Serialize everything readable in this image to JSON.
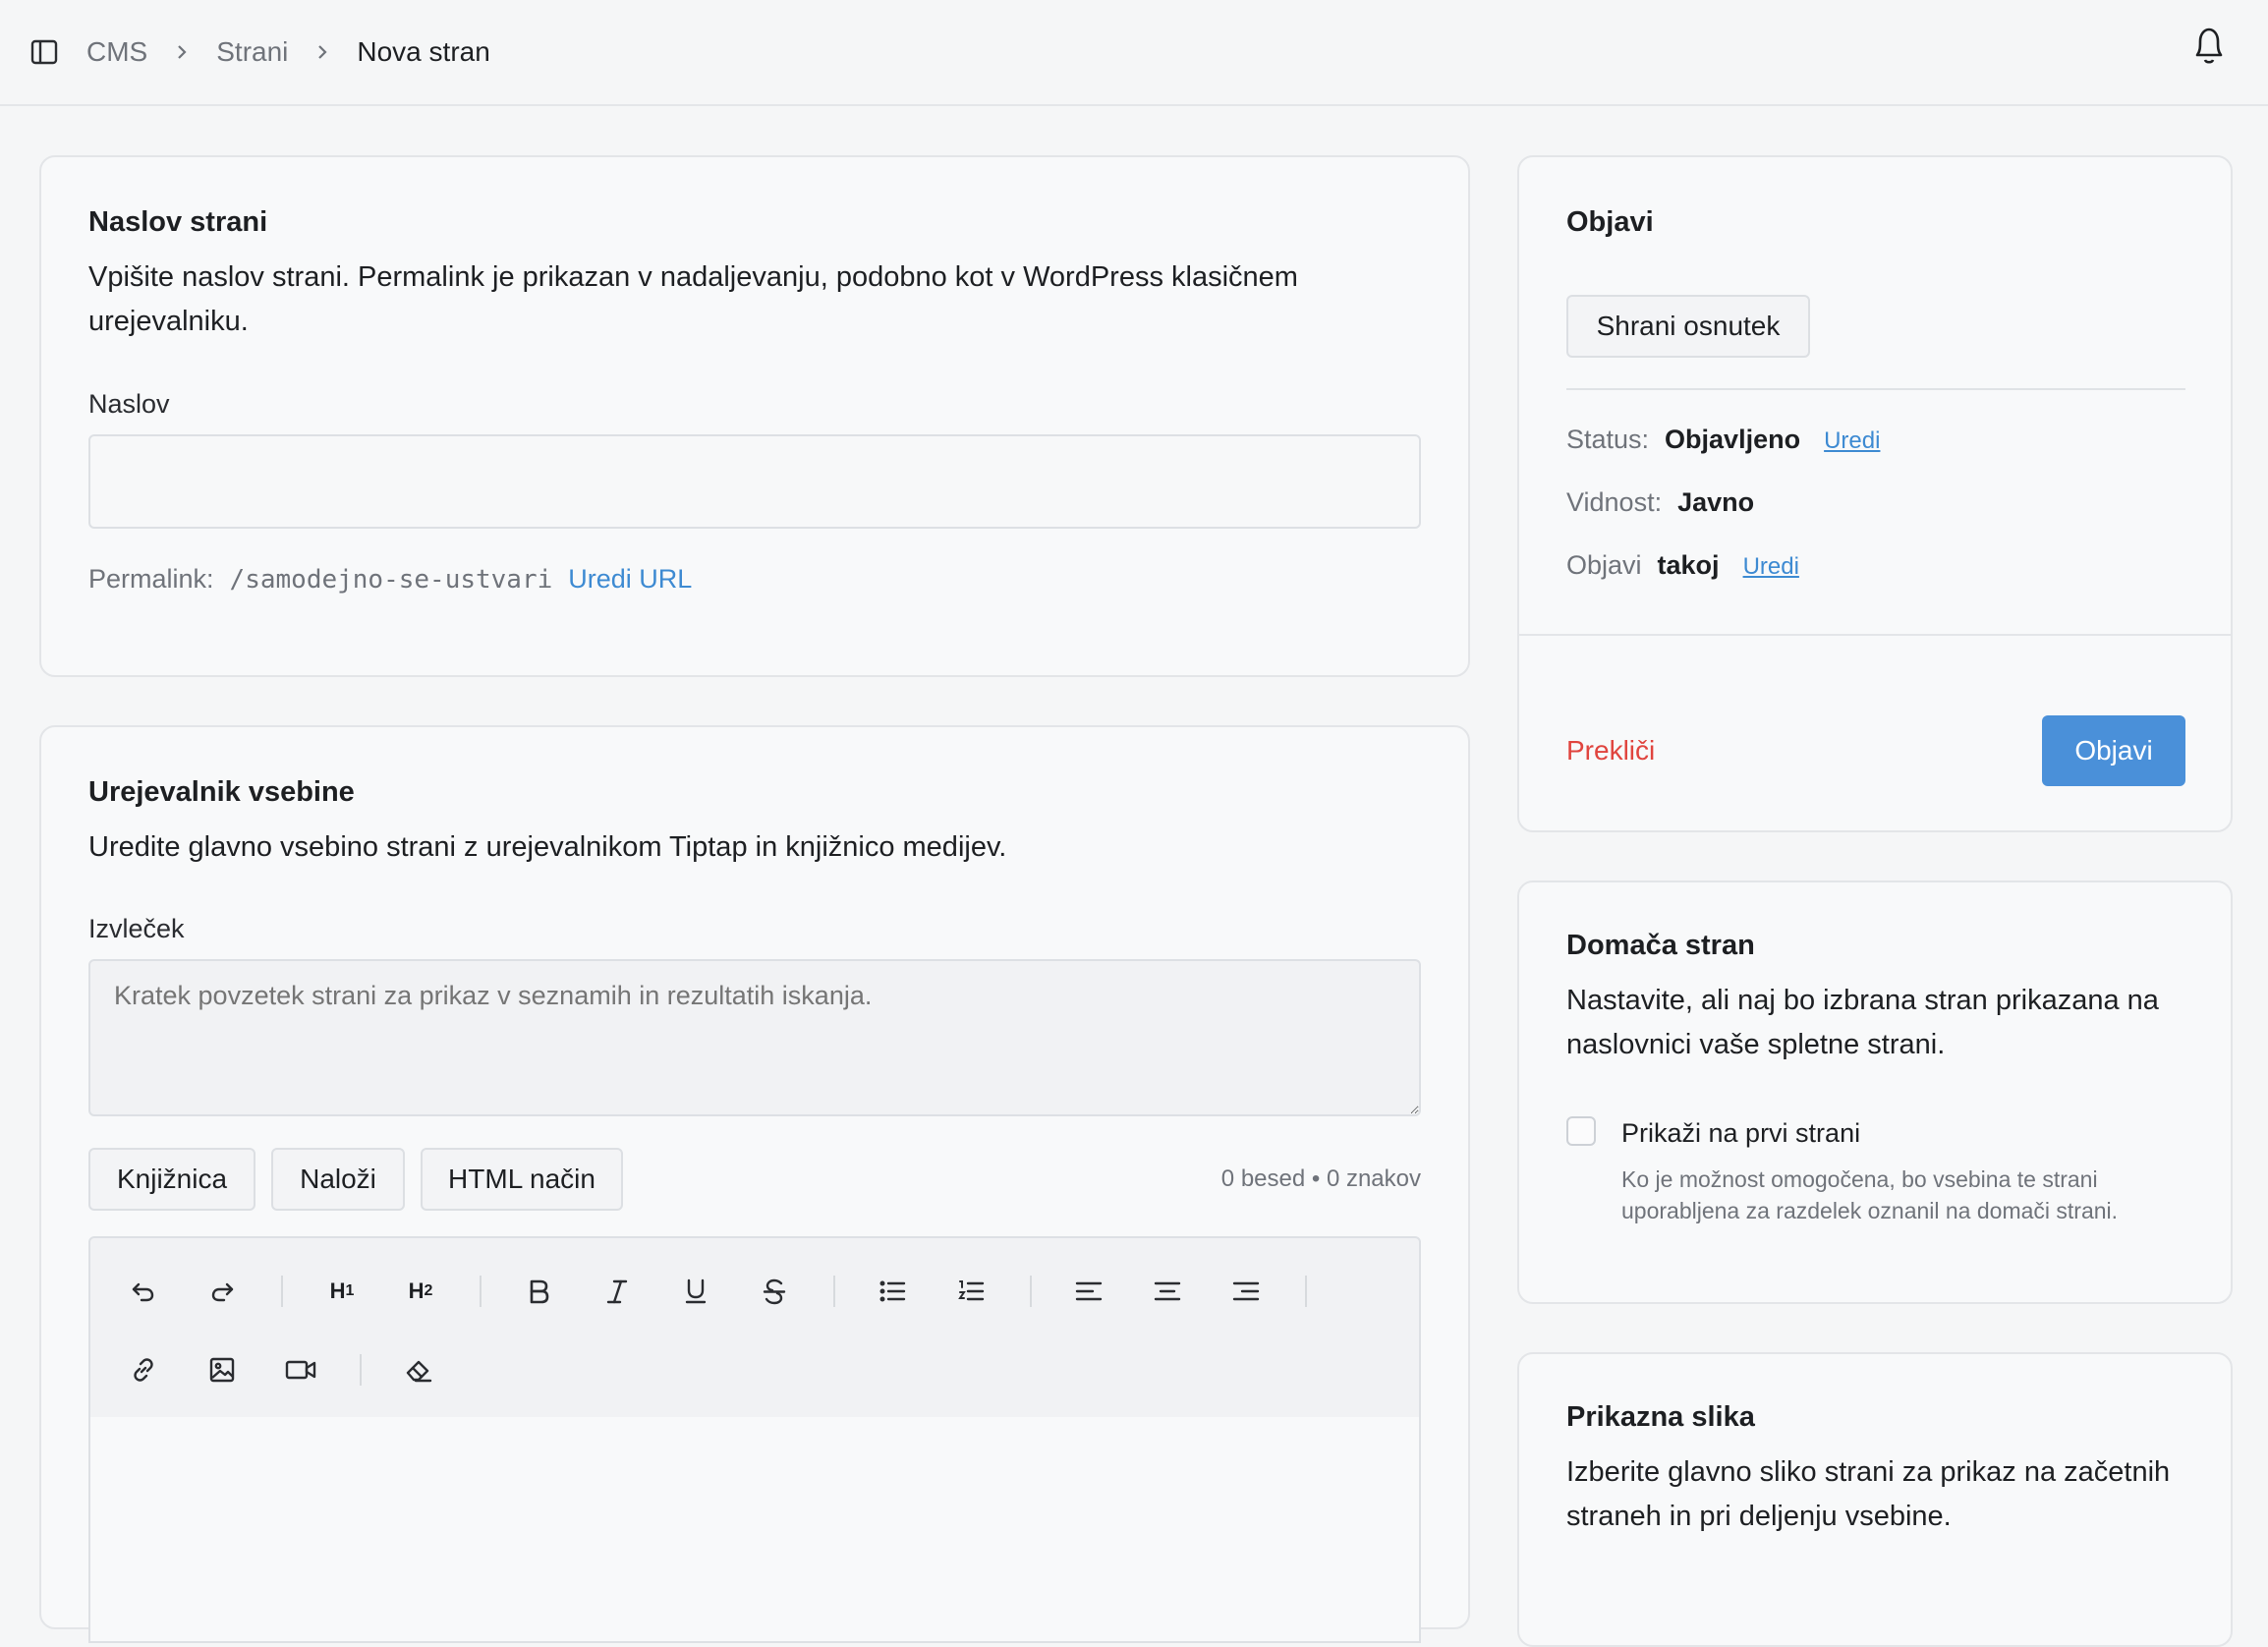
{
  "breadcrumb": {
    "items": [
      "CMS",
      "Strani"
    ],
    "current": "Nova stran"
  },
  "title_card": {
    "heading": "Naslov strani",
    "description": "Vpišite naslov strani. Permalink je prikazan v nadaljevanju, podobno kot v WordPress klasičnem urejevalniku.",
    "field_label": "Naslov",
    "field_value": "",
    "permalink_label": "Permalink:",
    "permalink_value": "/samodejno-se-ustvari",
    "permalink_edit": "Uredi URL"
  },
  "editor_card": {
    "heading": "Urejevalnik vsebine",
    "description": "Uredite glavno vsebino strani z urejevalnikom Tiptap in knjižnico medijev.",
    "excerpt_label": "Izvleček",
    "excerpt_placeholder": "Kratek povzetek strani za prikaz v seznamih in rezultatih iskanja.",
    "buttons": {
      "library": "Knjižnica",
      "upload": "Naloži",
      "html_mode": "HTML način"
    },
    "counter": "0 besed • 0 znakov",
    "toolbar_icons": [
      "undo-icon",
      "redo-icon",
      "heading-1-icon",
      "heading-2-icon",
      "bold-icon",
      "italic-icon",
      "underline-icon",
      "strikethrough-icon",
      "bullet-list-icon",
      "ordered-list-icon",
      "align-left-icon",
      "align-center-icon",
      "align-right-icon",
      "link-icon",
      "image-icon",
      "video-icon",
      "eraser-icon"
    ]
  },
  "publish_card": {
    "heading": "Objavi",
    "save_draft": "Shrani osnutek",
    "status_label": "Status:",
    "status_value": "Objavljeno",
    "status_edit": "Uredi",
    "visibility_label": "Vidnost:",
    "visibility_value": "Javno",
    "publish_label": "Objavi",
    "publish_value": "takoj",
    "publish_edit": "Uredi",
    "cancel": "Prekliči",
    "publish_button": "Objavi"
  },
  "homepage_card": {
    "heading": "Domača stran",
    "description": "Nastavite, ali naj bo izbrana stran prikazana na naslovnici vaše spletne strani.",
    "checkbox_label": "Prikaži na prvi strani",
    "checkbox_checked": false,
    "checkbox_help": "Ko je možnost omogočena, bo vsebina te strani uporabljena za razdelek oznanil na domači strani."
  },
  "featured_card": {
    "heading": "Prikazna slika",
    "description": "Izberite glavno sliko strani za prikaz na začetnih straneh in pri deljenju vsebine."
  },
  "colors": {
    "accent": "#4a90d9",
    "danger": "#e0443e",
    "link": "#3d8ad2"
  }
}
